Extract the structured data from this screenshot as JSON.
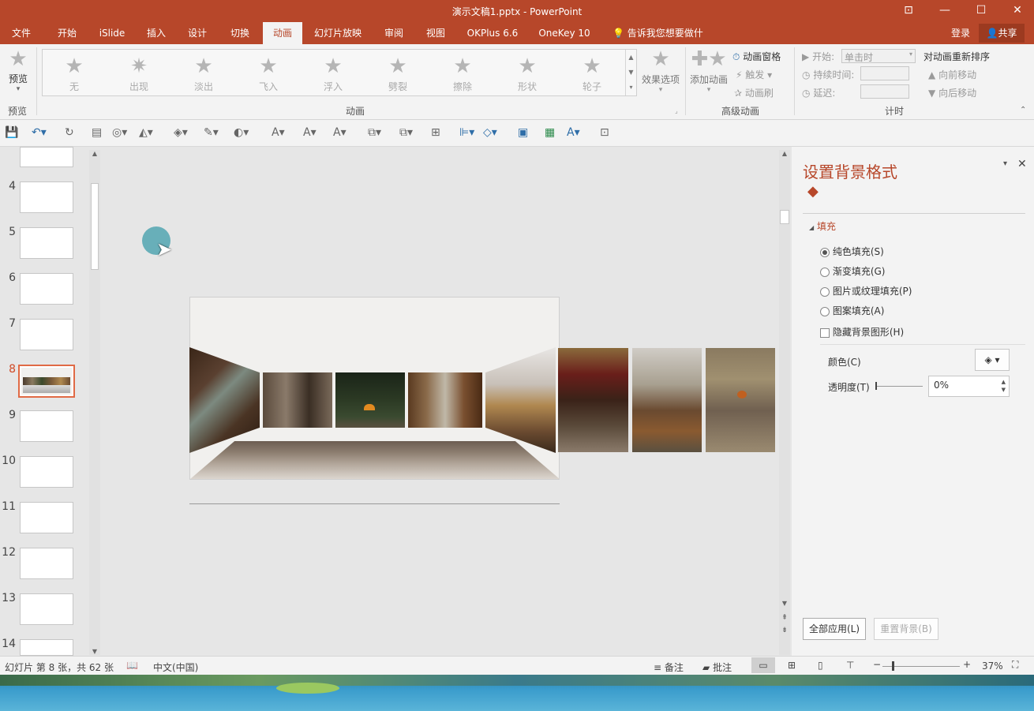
{
  "window": {
    "title": "演示文稿1.pptx - PowerPoint",
    "ribbon_display": "⊡",
    "minimize": "—",
    "maximize": "☐",
    "close": "✕"
  },
  "tabs": [
    "文件",
    "开始",
    "iSlide",
    "插入",
    "设计",
    "切换",
    "动画",
    "幻灯片放映",
    "审阅",
    "视图",
    "OKPlus 6.6",
    "OneKey 10"
  ],
  "active_tab": "动画",
  "tellme": "告诉我您想要做什么...",
  "signin": "登录",
  "share": "共享",
  "ribbon": {
    "preview_label": "预览",
    "preview_group": "预览",
    "animations_group": "动画",
    "gallery": [
      "无",
      "出现",
      "淡出",
      "飞入",
      "浮入",
      "劈裂",
      "擦除",
      "形状",
      "轮子"
    ],
    "effect_options": "效果选项",
    "add_animation": "添加动画",
    "animation_pane": "动画窗格",
    "trigger": "触发",
    "animation_painter": "动画刷",
    "advanced_group": "高级动画",
    "start_label": "开始:",
    "start_value": "单击时",
    "duration_label": "持续时间:",
    "delay_label": "延迟:",
    "timing_group": "计时",
    "reorder_title": "对动画重新排序",
    "move_earlier": "向前移动",
    "move_later": "向后移动"
  },
  "slides": [
    "4",
    "5",
    "6",
    "7",
    "8",
    "9",
    "10",
    "11",
    "12",
    "13",
    "14"
  ],
  "current_slide": "8",
  "format_pane": {
    "title": "设置背景格式",
    "section": "填充",
    "options": [
      "纯色填充(S)",
      "渐变填充(G)",
      "图片或纹理填充(P)",
      "图案填充(A)"
    ],
    "selected": "纯色填充(S)",
    "hide_bg": "隐藏背景图形(H)",
    "color_label": "颜色(C)",
    "transparency_label": "透明度(T)",
    "transparency_value": "0%",
    "apply_all": "全部应用(L)",
    "reset_bg": "重置背景(B)"
  },
  "status": {
    "slide_info": "幻灯片 第 8 张，共 62 张",
    "language": "中文(中国)",
    "notes": "备注",
    "comments": "批注",
    "zoom": "37%"
  },
  "colors": {
    "accent": "#b7472a",
    "slide_bg": "#f1f0ee",
    "cursor_highlight": "#5aa8b4"
  }
}
